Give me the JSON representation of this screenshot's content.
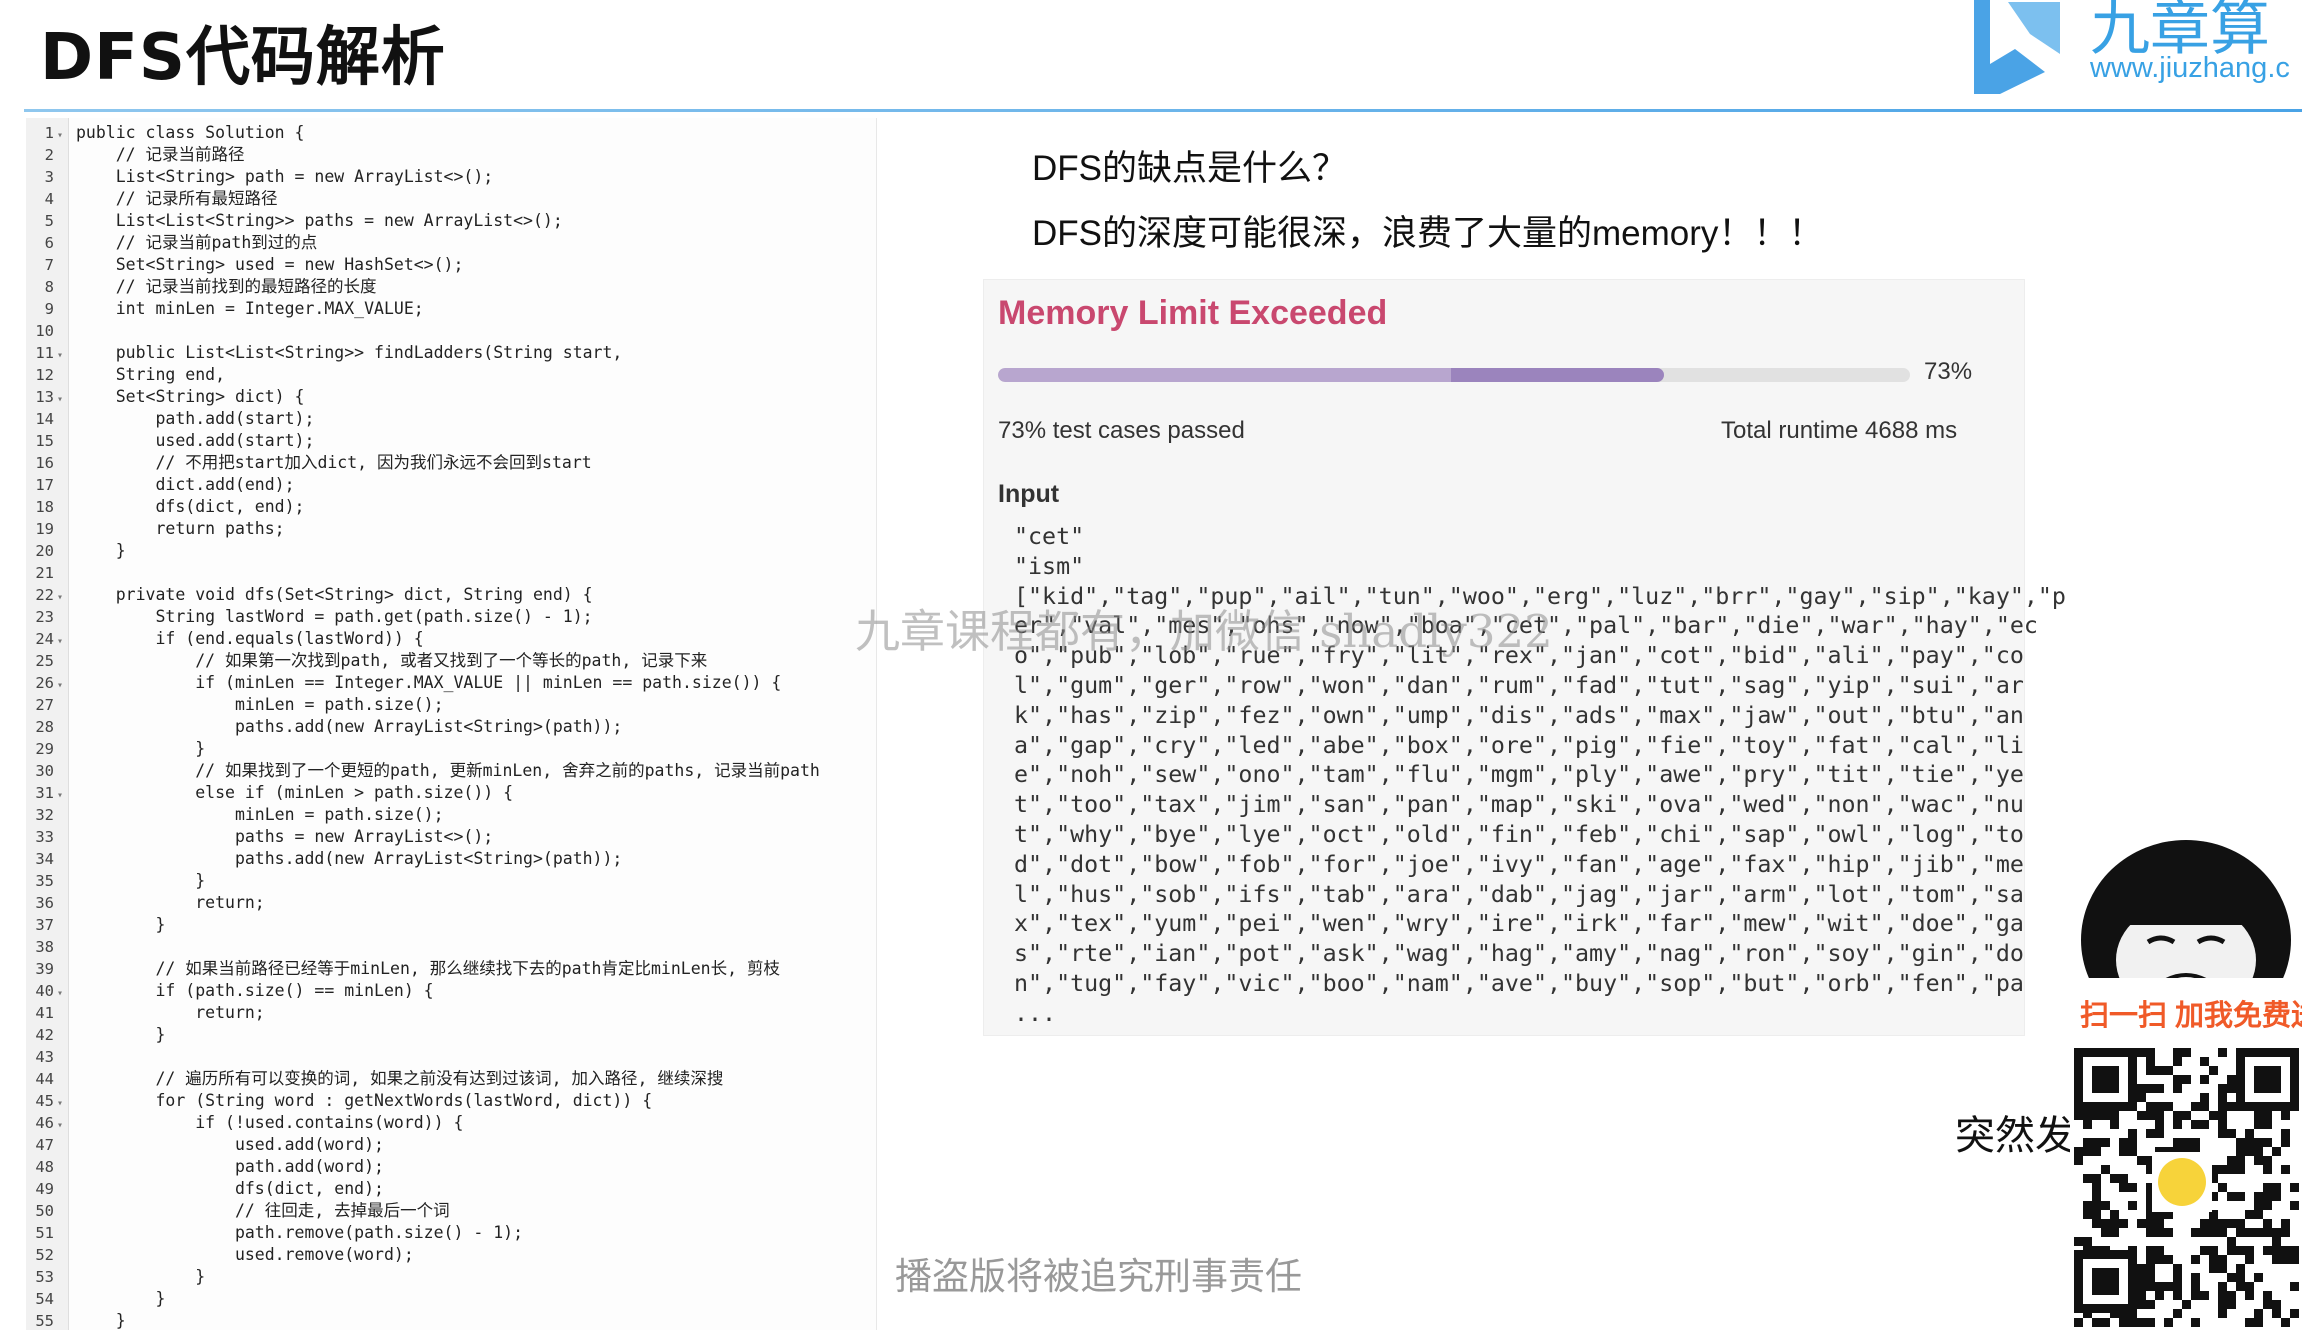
{
  "slide": {
    "title": "DFS代码解析"
  },
  "logo": {
    "brand_text": "九章算",
    "url_text": "www.jiuzhang.c"
  },
  "code": {
    "lines": [
      {
        "n": "1",
        "fold": true,
        "text": "public class Solution {"
      },
      {
        "n": "2",
        "fold": false,
        "text": "    // 记录当前路径"
      },
      {
        "n": "3",
        "fold": false,
        "text": "    List<String> path = new ArrayList<>();"
      },
      {
        "n": "4",
        "fold": false,
        "text": "    // 记录所有最短路径"
      },
      {
        "n": "5",
        "fold": false,
        "text": "    List<List<String>> paths = new ArrayList<>();"
      },
      {
        "n": "6",
        "fold": false,
        "text": "    // 记录当前path到过的点"
      },
      {
        "n": "7",
        "fold": false,
        "text": "    Set<String> used = new HashSet<>();"
      },
      {
        "n": "8",
        "fold": false,
        "text": "    // 记录当前找到的最短路径的长度"
      },
      {
        "n": "9",
        "fold": false,
        "text": "    int minLen = Integer.MAX_VALUE;"
      },
      {
        "n": "10",
        "fold": false,
        "text": ""
      },
      {
        "n": "11",
        "fold": true,
        "text": "    public List<List<String>> findLadders(String start,"
      },
      {
        "n": "12",
        "fold": false,
        "text": "    String end,"
      },
      {
        "n": "13",
        "fold": true,
        "text": "    Set<String> dict) {"
      },
      {
        "n": "14",
        "fold": false,
        "text": "        path.add(start);"
      },
      {
        "n": "15",
        "fold": false,
        "text": "        used.add(start);"
      },
      {
        "n": "16",
        "fold": false,
        "text": "        // 不用把start加入dict, 因为我们永远不会回到start"
      },
      {
        "n": "17",
        "fold": false,
        "text": "        dict.add(end);"
      },
      {
        "n": "18",
        "fold": false,
        "text": "        dfs(dict, end);"
      },
      {
        "n": "19",
        "fold": false,
        "text": "        return paths;"
      },
      {
        "n": "20",
        "fold": false,
        "text": "    }"
      },
      {
        "n": "21",
        "fold": false,
        "text": ""
      },
      {
        "n": "22",
        "fold": true,
        "text": "    private void dfs(Set<String> dict, String end) {"
      },
      {
        "n": "23",
        "fold": false,
        "text": "        String lastWord = path.get(path.size() - 1);"
      },
      {
        "n": "24",
        "fold": true,
        "text": "        if (end.equals(lastWord)) {"
      },
      {
        "n": "25",
        "fold": false,
        "text": "            // 如果第一次找到path, 或者又找到了一个等长的path, 记录下来"
      },
      {
        "n": "26",
        "fold": true,
        "text": "            if (minLen == Integer.MAX_VALUE || minLen == path.size()) {"
      },
      {
        "n": "27",
        "fold": false,
        "text": "                minLen = path.size();"
      },
      {
        "n": "28",
        "fold": false,
        "text": "                paths.add(new ArrayList<String>(path));"
      },
      {
        "n": "29",
        "fold": false,
        "text": "            }"
      },
      {
        "n": "30",
        "fold": false,
        "text": "            // 如果找到了一个更短的path, 更新minLen, 舍弃之前的paths, 记录当前path"
      },
      {
        "n": "31",
        "fold": true,
        "text": "            else if (minLen > path.size()) {"
      },
      {
        "n": "32",
        "fold": false,
        "text": "                minLen = path.size();"
      },
      {
        "n": "33",
        "fold": false,
        "text": "                paths = new ArrayList<>();"
      },
      {
        "n": "34",
        "fold": false,
        "text": "                paths.add(new ArrayList<String>(path));"
      },
      {
        "n": "35",
        "fold": false,
        "text": "            }"
      },
      {
        "n": "36",
        "fold": false,
        "text": "            return;"
      },
      {
        "n": "37",
        "fold": false,
        "text": "        }"
      },
      {
        "n": "38",
        "fold": false,
        "text": ""
      },
      {
        "n": "39",
        "fold": false,
        "text": "        // 如果当前路径已经等于minLen, 那么继续找下去的path肯定比minLen长, 剪枝"
      },
      {
        "n": "40",
        "fold": true,
        "text": "        if (path.size() == minLen) {"
      },
      {
        "n": "41",
        "fold": false,
        "text": "            return;"
      },
      {
        "n": "42",
        "fold": false,
        "text": "        }"
      },
      {
        "n": "43",
        "fold": false,
        "text": ""
      },
      {
        "n": "44",
        "fold": false,
        "text": "        // 遍历所有可以变换的词, 如果之前没有达到过该词, 加入路径, 继续深搜"
      },
      {
        "n": "45",
        "fold": true,
        "text": "        for (String word : getNextWords(lastWord, dict)) {"
      },
      {
        "n": "46",
        "fold": true,
        "text": "            if (!used.contains(word)) {"
      },
      {
        "n": "47",
        "fold": false,
        "text": "                used.add(word);"
      },
      {
        "n": "48",
        "fold": false,
        "text": "                path.add(word);"
      },
      {
        "n": "49",
        "fold": false,
        "text": "                dfs(dict, end);"
      },
      {
        "n": "50",
        "fold": false,
        "text": "                // 往回走, 去掉最后一个词"
      },
      {
        "n": "51",
        "fold": false,
        "text": "                path.remove(path.size() - 1);"
      },
      {
        "n": "52",
        "fold": false,
        "text": "                used.remove(word);"
      },
      {
        "n": "53",
        "fold": false,
        "text": "            }"
      },
      {
        "n": "54",
        "fold": false,
        "text": "        }"
      },
      {
        "n": "55",
        "fold": false,
        "text": "    }"
      }
    ]
  },
  "question": "DFS的缺点是什么？",
  "answer": "DFS的深度可能很深，浪费了大量的memory！！！",
  "result": {
    "title": "Memory Limit Exceeded",
    "progress_fraction": 0.73,
    "percent_label": "73%",
    "passed_text": "73% test cases passed",
    "runtime_text": "Total runtime 4688 ms",
    "input_label": "Input",
    "input_lines": [
      "\"cet\"",
      "\"ism\"",
      "[\"kid\",\"tag\",\"pup\",\"ail\",\"tun\",\"woo\",\"erg\",\"luz\",\"brr\",\"gay\",\"sip\",\"kay\",\"p",
      "er\",\"val\",\"mes\",\"ohs\",\"now\",\"boa\",\"cet\",\"pal\",\"bar\",\"die\",\"war\",\"hay\",\"ec",
      "o\",\"pub\",\"lob\",\"rue\",\"fry\",\"lit\",\"rex\",\"jan\",\"cot\",\"bid\",\"ali\",\"pay\",\"co",
      "l\",\"gum\",\"ger\",\"row\",\"won\",\"dan\",\"rum\",\"fad\",\"tut\",\"sag\",\"yip\",\"sui\",\"ar",
      "k\",\"has\",\"zip\",\"fez\",\"own\",\"ump\",\"dis\",\"ads\",\"max\",\"jaw\",\"out\",\"btu\",\"an",
      "a\",\"gap\",\"cry\",\"led\",\"abe\",\"box\",\"ore\",\"pig\",\"fie\",\"toy\",\"fat\",\"cal\",\"li",
      "e\",\"noh\",\"sew\",\"ono\",\"tam\",\"flu\",\"mgm\",\"ply\",\"awe\",\"pry\",\"tit\",\"tie\",\"ye",
      "t\",\"too\",\"tax\",\"jim\",\"san\",\"pan\",\"map\",\"ski\",\"ova\",\"wed\",\"non\",\"wac\",\"nu",
      "t\",\"why\",\"bye\",\"lye\",\"oct\",\"old\",\"fin\",\"feb\",\"chi\",\"sap\",\"owl\",\"log\",\"to",
      "d\",\"dot\",\"bow\",\"fob\",\"for\",\"joe\",\"ivy\",\"fan\",\"age\",\"fax\",\"hip\",\"jib\",\"me",
      "l\",\"hus\",\"sob\",\"ifs\",\"tab\",\"ara\",\"dab\",\"jag\",\"jar\",\"arm\",\"lot\",\"tom\",\"sa",
      "x\",\"tex\",\"yum\",\"pei\",\"wen\",\"wry\",\"ire\",\"irk\",\"far\",\"mew\",\"wit\",\"doe\",\"ga",
      "s\",\"rte\",\"ian\",\"pot\",\"ask\",\"wag\",\"hag\",\"amy\",\"nag\",\"ron\",\"soy\",\"gin\",\"do",
      "n\",\"tug\",\"fay\",\"vic\",\"boo\",\"nam\",\"ave\",\"buy\",\"sop\",\"but\",\"orb\",\"fen\",\"pa",
      "..."
    ]
  },
  "watermark": "九章课程都有，加微信 shadly322",
  "footer_notice": "播盗版将被追究刑事责任",
  "overlay": {
    "sudden_text": "突然发",
    "scan_text": "扫一扫 加我免费送"
  },
  "colors": {
    "accent_blue": "#38a1e4",
    "error_title": "#c9486f",
    "progress_light": "#b8a6cf",
    "progress_dark": "#9b84bd",
    "scan_orange": "#f05a28"
  }
}
